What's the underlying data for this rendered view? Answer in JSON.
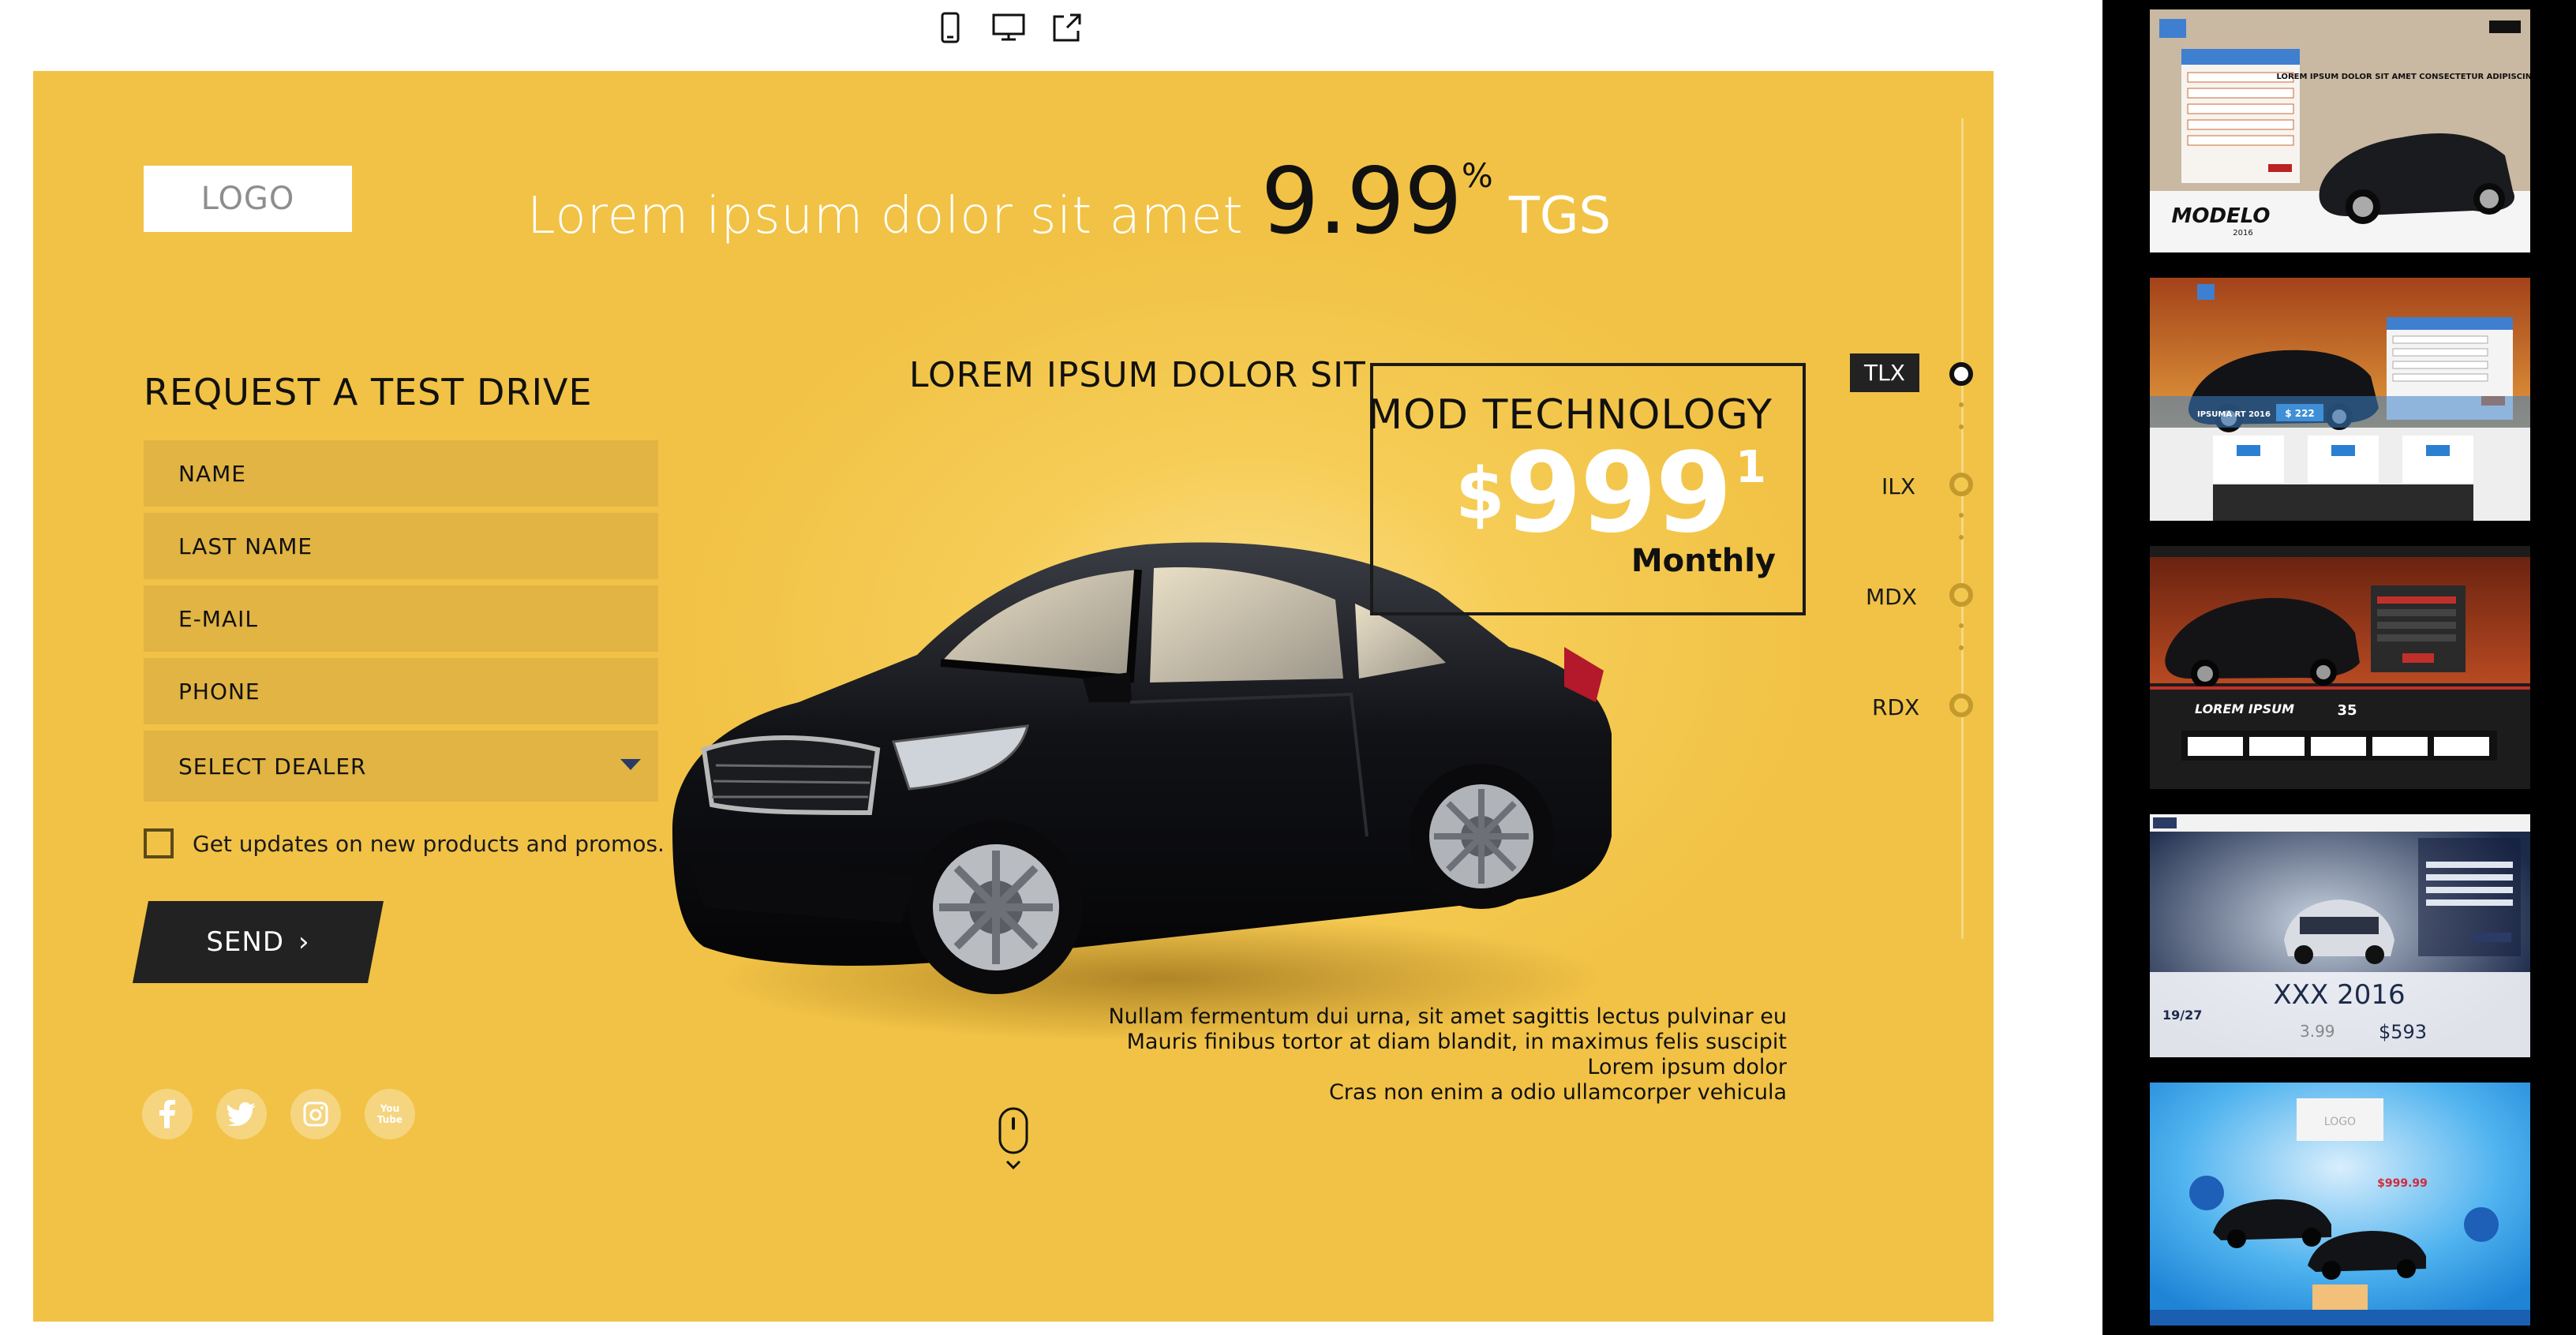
{
  "toolbar": {
    "devices": [
      {
        "name": "mobile",
        "icon": "phone-icon"
      },
      {
        "name": "desktop",
        "icon": "desktop-icon"
      },
      {
        "name": "open",
        "icon": "external-link-icon"
      }
    ]
  },
  "hero": {
    "logo": "LOGO",
    "headline_text": "Lorem ipsum dolor sit amet",
    "rate": "9.99",
    "rate_suffix": "%",
    "rate_unit": "TGS"
  },
  "form": {
    "title": "REQUEST A TEST DRIVE",
    "fields": {
      "name": "NAME",
      "last_name": "LAST NAME",
      "email": "E-MAIL",
      "phone": "PHONE",
      "dealer": "SELECT DEALER"
    },
    "checkbox_label": "Get updates on new products and promos.",
    "send_label": "SEND",
    "send_arrow": "›"
  },
  "social": [
    {
      "name": "facebook",
      "glyph": "f"
    },
    {
      "name": "twitter",
      "glyph": "t"
    },
    {
      "name": "instagram",
      "glyph": "◎"
    },
    {
      "name": "youtube",
      "glyph": "You Tube"
    }
  ],
  "offer": {
    "subtitle": "LOREM IPSUM DOLOR SIT",
    "box_title": "MOD TECHNOLOGY",
    "currency": "$",
    "amount": "999",
    "footnote": "1",
    "period": "Monthly"
  },
  "description": {
    "line1": "Nullam fermentum dui urna, sit amet sagittis lectus pulvinar eu",
    "line2": "Mauris finibus tortor at diam blandit, in maximus felis suscipit",
    "line3": "Lorem ipsum dolor",
    "line4": "Cras non enim a odio ullamcorper vehicula"
  },
  "models": {
    "items": [
      "TLX",
      "ILX",
      "MDX",
      "RDX"
    ],
    "active": "TLX"
  },
  "thumbnails": {
    "t1": {
      "caption": "MODELO",
      "sub": "2016",
      "heading": "LOREM IPSUM DOLOR SIT AMET CONSECTETUR ADIPISCING ELIT"
    },
    "t2": {
      "caption": "IPSUMA RT 2016",
      "price": "$ 222"
    },
    "t3": {
      "caption": "LOREM IPSUM",
      "stat": "35"
    },
    "t4": {
      "caption": "XXX 2016",
      "apr": "3.99",
      "price": "$593",
      "mpg": "19/27"
    },
    "t5": {
      "caption": "LOGO",
      "price": "$999.99"
    }
  },
  "colors": {
    "stage_yellow": "#f3c84f",
    "dark": "#222222",
    "accent_blue": "#2b3b66"
  }
}
